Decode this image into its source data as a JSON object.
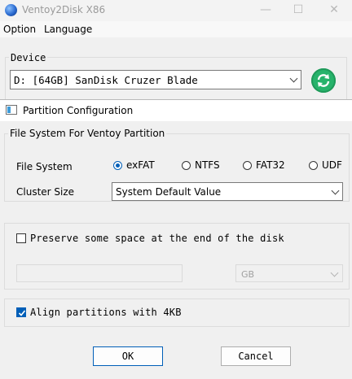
{
  "main_window": {
    "title": "Ventoy2Disk  X86",
    "menu": [
      "Option",
      "Language"
    ],
    "device_label": "Device",
    "device_value": "D: [64GB] SanDisk Cruzer Blade",
    "controls": {
      "minimize": "—",
      "maximize": "☐",
      "close": "✕"
    }
  },
  "dialog": {
    "title": "Partition Configuration",
    "fs_group_label": "File System For Ventoy Partition",
    "file_system_label": "File System",
    "file_system_options": [
      "exFAT",
      "NTFS",
      "FAT32",
      "UDF"
    ],
    "file_system_selected": "exFAT",
    "cluster_size_label": "Cluster Size",
    "cluster_size_value": "System Default Value",
    "preserve_label": "Preserve some space at the end of the disk",
    "preserve_checked": false,
    "preserve_size_value": "",
    "preserve_unit": "GB",
    "align_label": "Align partitions with 4KB",
    "align_checked": true,
    "ok_label": "OK",
    "cancel_label": "Cancel"
  },
  "colors": {
    "accent": "#005fb8",
    "refresh": "#27b36b"
  }
}
